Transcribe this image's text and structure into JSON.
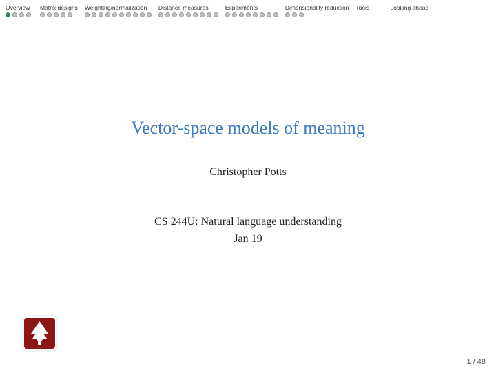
{
  "nav": {
    "sections": [
      {
        "label": "Overview",
        "dots": [
          {
            "state": "active"
          },
          {
            "state": "empty"
          },
          {
            "state": "empty"
          },
          {
            "state": "empty"
          }
        ]
      },
      {
        "label": "Matrix designs",
        "dots": [
          {
            "state": "empty"
          },
          {
            "state": "empty"
          },
          {
            "state": "empty"
          },
          {
            "state": "empty"
          },
          {
            "state": "empty"
          }
        ]
      },
      {
        "label": "Weighting/normalization",
        "dots": [
          {
            "state": "empty"
          },
          {
            "state": "empty"
          },
          {
            "state": "empty"
          },
          {
            "state": "empty"
          },
          {
            "state": "empty"
          },
          {
            "state": "empty"
          },
          {
            "state": "empty"
          },
          {
            "state": "empty"
          },
          {
            "state": "empty"
          },
          {
            "state": "empty"
          }
        ]
      },
      {
        "label": "Distance measures",
        "dots": [
          {
            "state": "empty"
          },
          {
            "state": "empty"
          },
          {
            "state": "empty"
          },
          {
            "state": "empty"
          },
          {
            "state": "empty"
          },
          {
            "state": "empty"
          },
          {
            "state": "empty"
          },
          {
            "state": "empty"
          },
          {
            "state": "empty"
          }
        ]
      },
      {
        "label": "Experiments",
        "dots": [
          {
            "state": "empty"
          },
          {
            "state": "empty"
          },
          {
            "state": "empty"
          },
          {
            "state": "empty"
          },
          {
            "state": "empty"
          },
          {
            "state": "empty"
          },
          {
            "state": "empty"
          },
          {
            "state": "empty"
          }
        ]
      },
      {
        "label": "Dimensionality reduction",
        "dots": [
          {
            "state": "empty"
          },
          {
            "state": "empty"
          },
          {
            "state": "empty"
          }
        ]
      },
      {
        "label": "Tools",
        "dots": []
      },
      {
        "label": "Looking ahead",
        "dots": []
      }
    ]
  },
  "slide": {
    "title": "Vector-space models of meaning",
    "author": "Christopher Potts",
    "course_line1": "CS 244U: Natural language understanding",
    "course_line2": "Jan 19"
  },
  "page": {
    "current": "1",
    "total": "48",
    "separator": "/",
    "display": "1 / 48"
  }
}
